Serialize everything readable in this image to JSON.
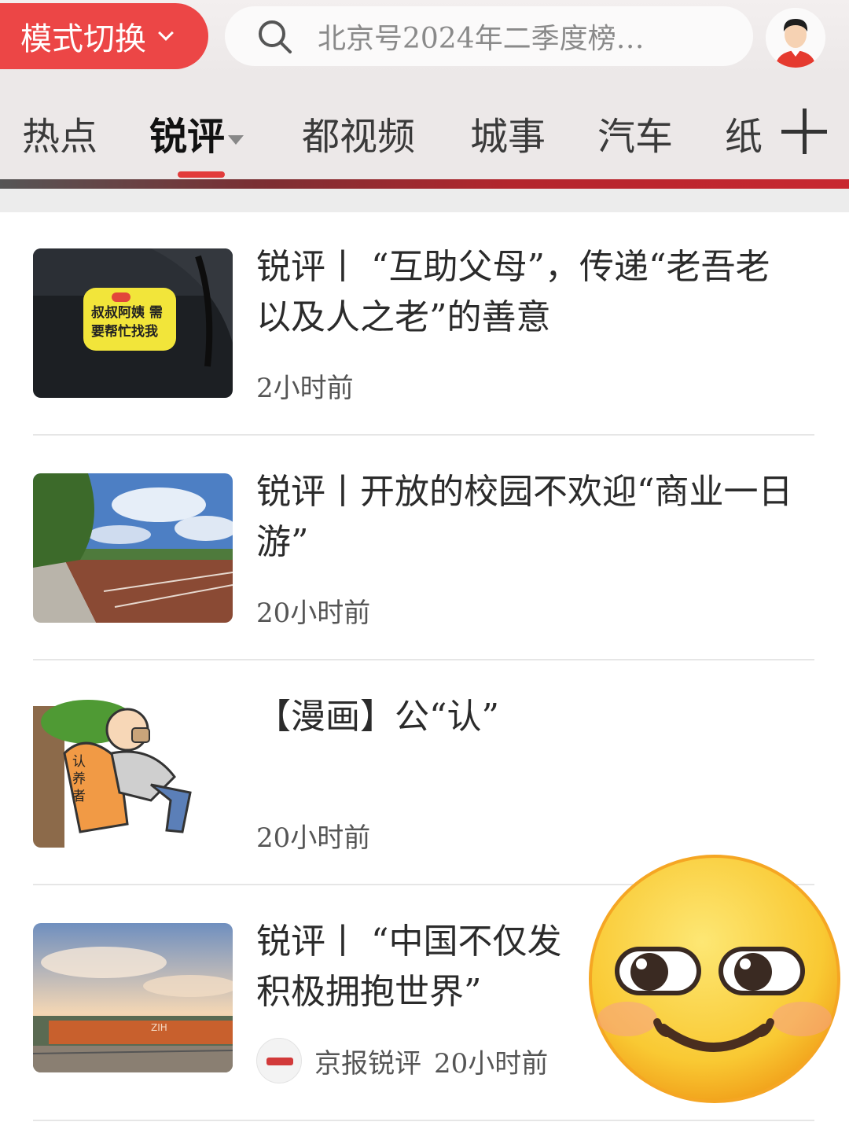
{
  "header": {
    "mode_button": "模式切换",
    "search_placeholder": "北京号2024年二季度榜…"
  },
  "tabs": [
    {
      "label": "热点"
    },
    {
      "label": "锐评"
    },
    {
      "label": "都视频"
    },
    {
      "label": "城事"
    },
    {
      "label": "汽车"
    },
    {
      "label": "纸"
    }
  ],
  "active_tab": "锐评",
  "feed": [
    {
      "title": "锐评丨 “互助父母”，传递“老吾老以及人之老”的善意",
      "time": "2小时前",
      "thumb_text": "叔叔阿姨 需要帮忙找我"
    },
    {
      "title": "锐评丨开放的校园不欢迎“商业一日游”",
      "time": "20小时前"
    },
    {
      "title": "【漫画】公“认”",
      "time": "20小时前",
      "thumb_text": "认养者"
    },
    {
      "title": "锐评丨 “中国不仅发",
      "title_line2": "积极拥抱世界”",
      "source": "京报锐评",
      "time": "20小时前",
      "thumb_text": "ZIH"
    }
  ],
  "colors": {
    "accent": "#e23b3b",
    "mode_button": "#ec4646",
    "emoji": "#fbd23a"
  }
}
